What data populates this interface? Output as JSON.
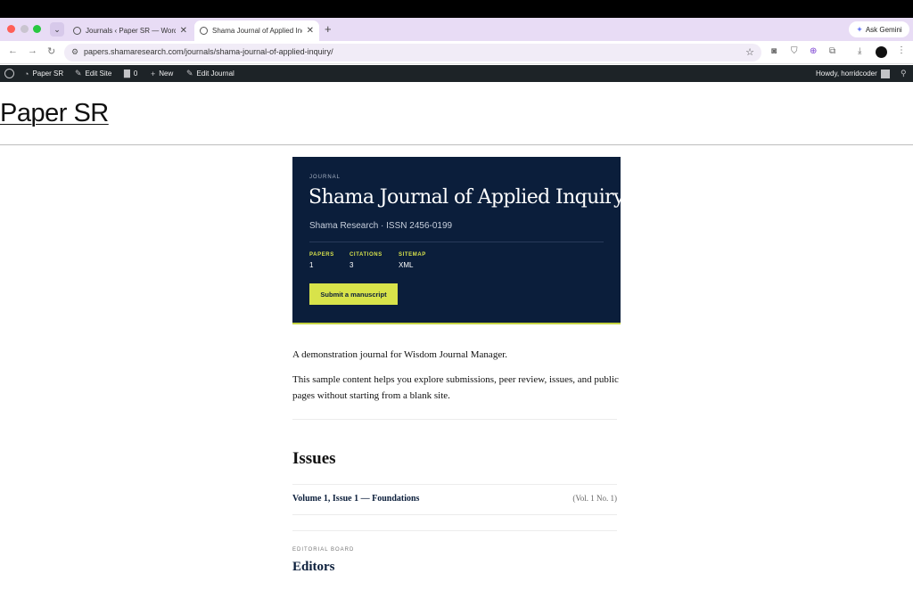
{
  "browser": {
    "tabs": [
      {
        "title": "Journals ‹ Paper SR — WordPress"
      },
      {
        "title": "Shama Journal of Applied Inquiry"
      }
    ],
    "new_tab_glyph": "+",
    "gemini_label": "Ask Gemini",
    "url": "papers.shamaresearch.com/journals/shama-journal-of-applied-inquiry/"
  },
  "adminbar": {
    "site_name": "Paper SR",
    "edit_site": "Edit Site",
    "comments_count": "0",
    "new_label": "New",
    "edit_journal": "Edit Journal",
    "howdy": "Howdy, horridcoder"
  },
  "site": {
    "title": "Paper SR"
  },
  "journal": {
    "kicker": "JOURNAL",
    "title": "Shama Journal of Applied Inquiry",
    "publisher_line": "Shama Research · ISSN 2456-0199",
    "stats": [
      {
        "label": "PAPERS",
        "value": "1"
      },
      {
        "label": "CITATIONS",
        "value": "3"
      },
      {
        "label": "SITEMAP",
        "value": "XML"
      }
    ],
    "submit_label": "Submit a manuscript",
    "accent_color": "#d8e34a",
    "card_color": "#0b1e3b"
  },
  "content": {
    "intro": "A demonstration journal for Wisdom Journal Manager.",
    "body": "This sample content helps you explore submissions, peer review, issues, and public pages without starting from a blank site."
  },
  "issues": {
    "heading": "Issues",
    "items": [
      {
        "title": "Volume 1, Issue 1 — Foundations",
        "meta": "(Vol. 1 No. 1)"
      }
    ]
  },
  "editorial": {
    "kicker": "EDITORIAL BOARD",
    "heading": "Editors"
  }
}
